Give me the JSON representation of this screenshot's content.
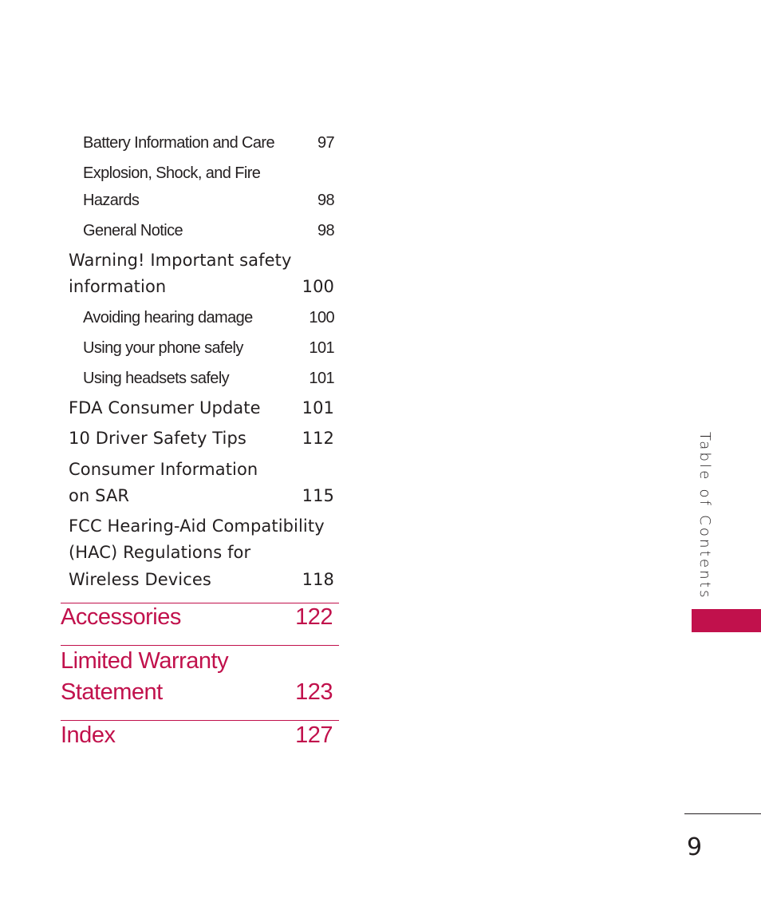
{
  "side_label": "Table of Contents",
  "page_number": "9",
  "colors": {
    "accent": "#c1114c",
    "text": "#231f20"
  },
  "entries": [
    {
      "level": "sub",
      "lines": [
        "Battery Information and Care"
      ],
      "page": "97"
    },
    {
      "level": "sub",
      "lines": [
        "Explosion, Shock, and Fire",
        "Hazards"
      ],
      "page": "98"
    },
    {
      "level": "sub",
      "lines": [
        "General Notice"
      ],
      "page": "98"
    },
    {
      "level": "main",
      "lines": [
        "Warning! Important safety",
        "information"
      ],
      "page": "100"
    },
    {
      "level": "sub",
      "lines": [
        "Avoiding hearing damage"
      ],
      "page": "100"
    },
    {
      "level": "sub",
      "lines": [
        "Using your phone safely"
      ],
      "page": "101"
    },
    {
      "level": "sub",
      "lines": [
        "Using headsets safely"
      ],
      "page": "101"
    },
    {
      "level": "main",
      "lines": [
        "FDA Consumer Update"
      ],
      "page": "101"
    },
    {
      "level": "main",
      "lines": [
        "10 Driver Safety Tips"
      ],
      "page": "112"
    },
    {
      "level": "main",
      "lines": [
        "Consumer Information",
        "on SAR"
      ],
      "page": "115"
    },
    {
      "level": "main",
      "lines": [
        "FCC Hearing-Aid Compatibility",
        "(HAC) Regulations for",
        "Wireless Devices"
      ],
      "page": "118"
    }
  ],
  "sections": [
    {
      "lines": [
        "Accessories"
      ],
      "page": "122"
    },
    {
      "lines": [
        "Limited Warranty",
        "Statement"
      ],
      "page": "123"
    },
    {
      "lines": [
        "Index"
      ],
      "page": "127"
    }
  ]
}
